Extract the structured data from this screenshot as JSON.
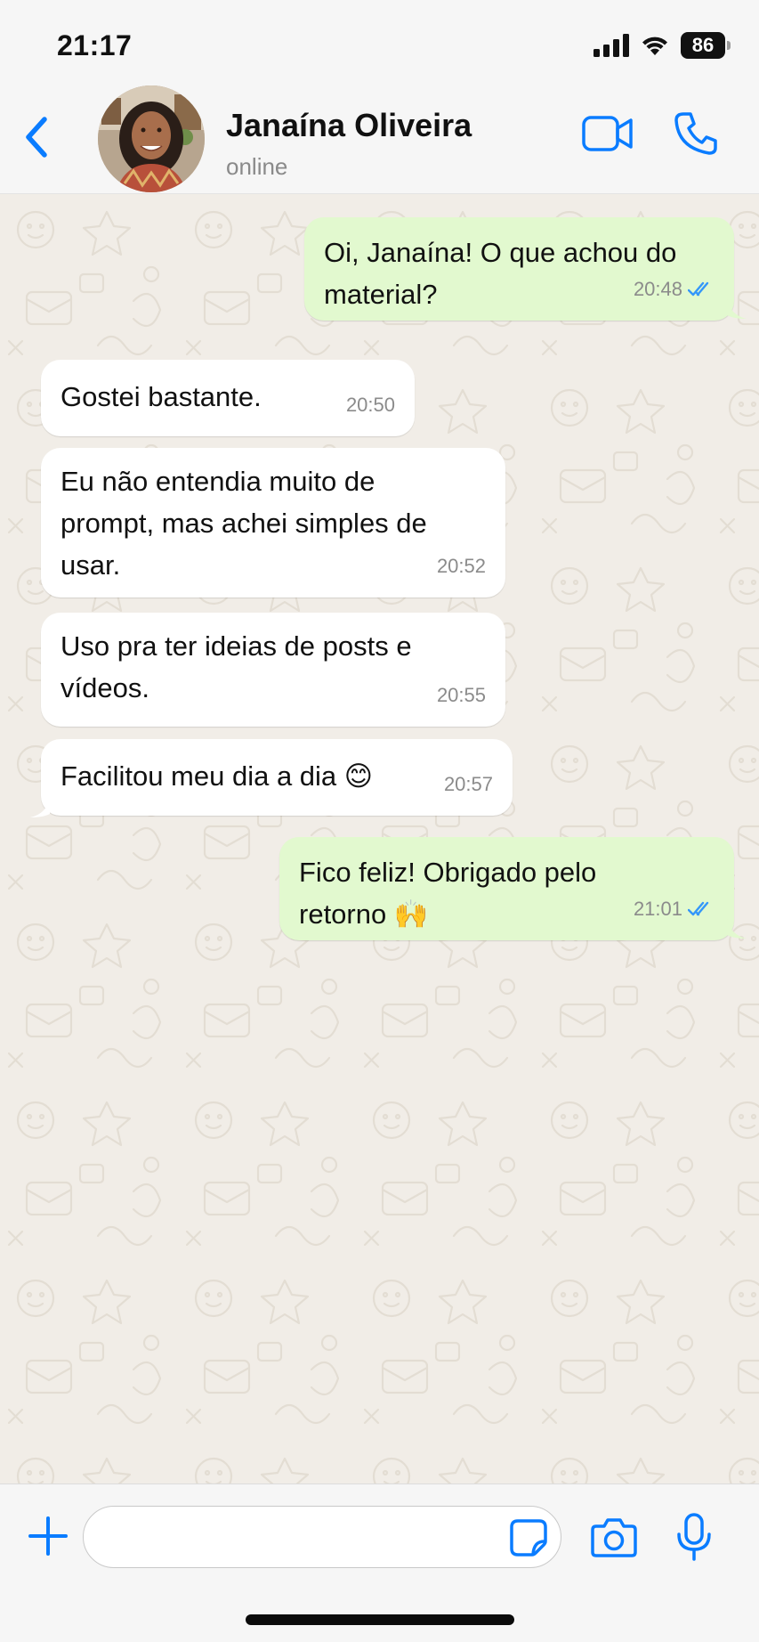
{
  "status_bar": {
    "time": "21:17",
    "battery": "86"
  },
  "header": {
    "contact_name": "Janaína Oliveira",
    "contact_status": "online"
  },
  "messages": [
    {
      "direction": "out",
      "text": "Oi, Janaína! O que achou do material?",
      "time": "20:48",
      "read": true
    },
    {
      "direction": "in",
      "text": "Gostei bastante.",
      "time": "20:50"
    },
    {
      "direction": "in",
      "text": "Eu não entendia muito de prompt, mas achei simples de usar.",
      "time": "20:52"
    },
    {
      "direction": "in",
      "text": "Uso pra ter ideias de posts e vídeos.",
      "time": "20:55"
    },
    {
      "direction": "in",
      "text": "Facilitou meu dia a dia 😊",
      "time": "20:57"
    },
    {
      "direction": "out",
      "text": "Fico feliz! Obrigado pelo retorno 🙌",
      "time": "21:01",
      "read": true
    }
  ],
  "input": {
    "placeholder": ""
  },
  "colors": {
    "accent": "#0a7cff",
    "outgoing_bubble": "#e2f9cf",
    "incoming_bubble": "#ffffff",
    "read_ticks": "#3497f9"
  }
}
